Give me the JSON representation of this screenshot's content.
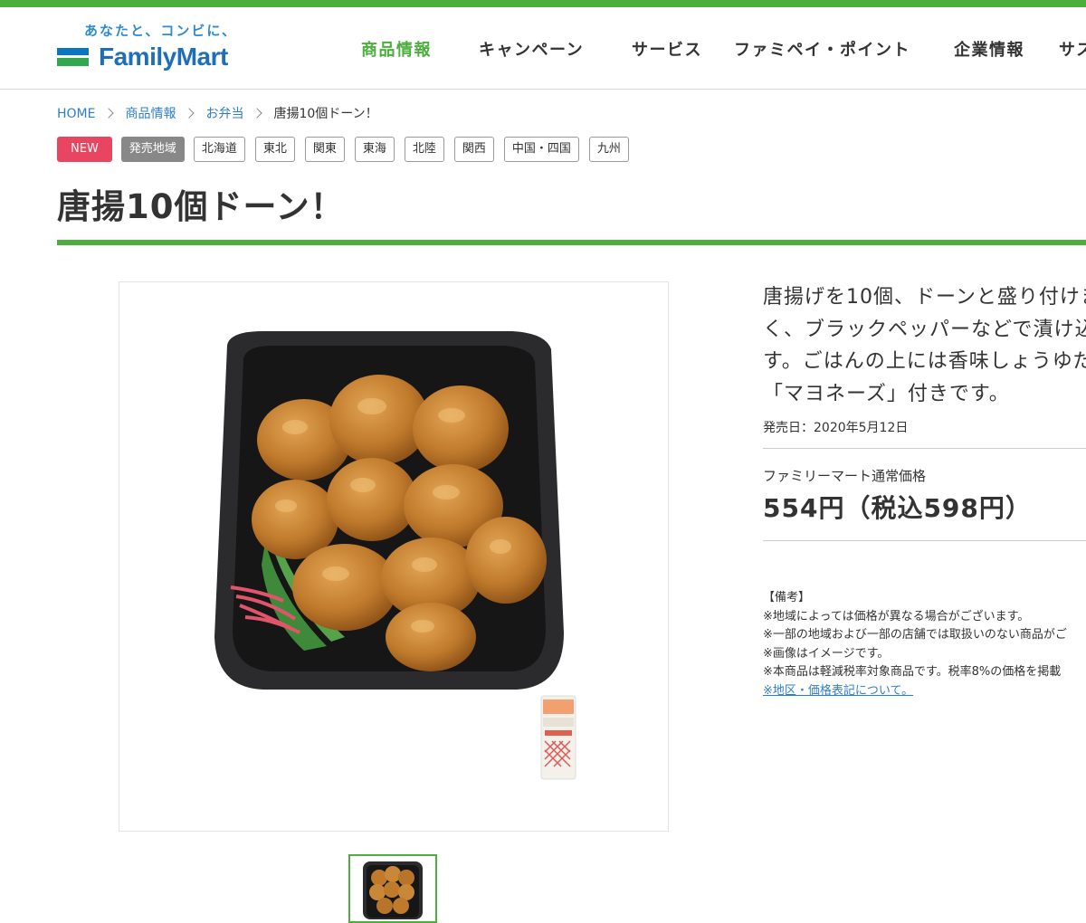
{
  "brand": {
    "tagline": "あなたと、コンビに、",
    "name": "FamilyMart",
    "colors": {
      "green": "#4caf3d",
      "blue": "#1f6fb8",
      "new_badge": "#e84560"
    }
  },
  "nav": {
    "items": [
      {
        "label": "商品情報",
        "active": true
      },
      {
        "label": "キャンペーン"
      },
      {
        "label": "サービス"
      },
      {
        "label": "ファミペイ・ポイント"
      },
      {
        "label": "企業情報"
      },
      {
        "label": "サス"
      }
    ]
  },
  "breadcrumb": {
    "items": [
      "HOME",
      "商品情報",
      "お弁当"
    ],
    "current": "唐揚10個ドーン！"
  },
  "tags": {
    "new": "NEW",
    "area_label": "発売地域",
    "regions": [
      "北海道",
      "東北",
      "関東",
      "東海",
      "北陸",
      "関西",
      "中国・四国",
      "九州"
    ]
  },
  "product": {
    "title": "唐揚10個ドーン！",
    "description_lines": [
      "唐揚げを10個、ドーンと盛り付けま",
      "く、ブラックペッパーなどで漬け込",
      "す。ごはんの上には香味しょうゆだ",
      "「マヨネーズ」付きです。"
    ],
    "release": "発売日：2020年5月12日",
    "price_label": "ファミリーマート通常価格",
    "price": "554円（税込598円）",
    "notes": {
      "heading": "【備考】",
      "lines": [
        "※地域によっては価格が異なる場合がございます。",
        "※一部の地域および一部の店舗では取扱いのない商品がご",
        "※画像はイメージです。",
        "※本商品は軽減税率対象商品です。税率8%の価格を掲載"
      ],
      "link": "※地区・価格表記について。"
    }
  },
  "images": {
    "main": "fried-chicken-bento-photo",
    "thumbnail": "fried-chicken-bento-thumbnail"
  }
}
